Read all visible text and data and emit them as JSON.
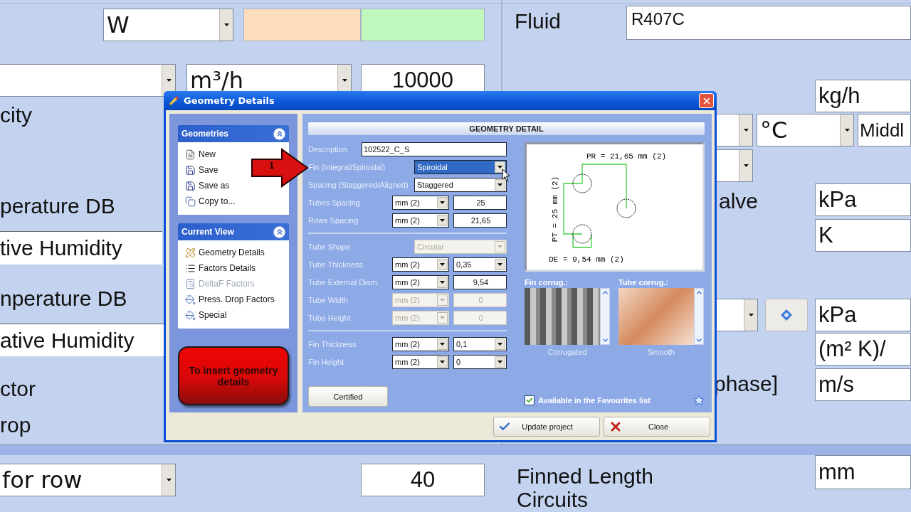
{
  "background": {
    "items": [
      {
        "kind": "combo",
        "text": "W"
      },
      {
        "kind": "swatch",
        "color": "#fddcbd"
      },
      {
        "kind": "swatch",
        "color": "#bff7bd"
      },
      {
        "kind": "combo"
      },
      {
        "kind": "combo",
        "text": "m³/h"
      },
      {
        "kind": "field",
        "text": "10000"
      },
      {
        "kind": "label",
        "text": "city"
      },
      {
        "kind": "label",
        "text": "perature DB"
      },
      {
        "kind": "strip",
        "text": "tive Humidity"
      },
      {
        "kind": "label",
        "text": "nperature DB"
      },
      {
        "kind": "strip",
        "text": "ative Humidity"
      },
      {
        "kind": "label",
        "text": "ctor"
      },
      {
        "kind": "label",
        "text": "rop"
      },
      {
        "kind": "combo",
        "text": "for row"
      },
      {
        "kind": "field",
        "text": "40"
      },
      {
        "kind": "label",
        "text": "Fluid"
      },
      {
        "kind": "field",
        "text": "R407C"
      },
      {
        "kind": "field",
        "text": "kg/h"
      },
      {
        "kind": "combo"
      },
      {
        "kind": "combo",
        "text": "°C"
      },
      {
        "kind": "field",
        "text": "Middl"
      },
      {
        "kind": "combo"
      },
      {
        "kind": "label",
        "text": "alve"
      },
      {
        "kind": "field",
        "text": "kPa"
      },
      {
        "kind": "field",
        "text": "K"
      },
      {
        "kind": "combo"
      },
      {
        "kind": "info"
      },
      {
        "kind": "field",
        "text": "kPa"
      },
      {
        "kind": "field",
        "text": "(m² K)/"
      },
      {
        "kind": "label",
        "text": "phase]"
      },
      {
        "kind": "field",
        "text": "m/s"
      },
      {
        "kind": "label",
        "text": "Finned Length"
      },
      {
        "kind": "field",
        "text": "mm"
      },
      {
        "kind": "label",
        "text": "Circuits"
      }
    ]
  },
  "dialog": {
    "title": "Geometry Details",
    "sidebar": {
      "groups": [
        {
          "title": "Geometries",
          "expanded": true,
          "items": [
            {
              "label": "New",
              "kind": "new",
              "disabled": false
            },
            {
              "label": "Save",
              "kind": "save",
              "disabled": false
            },
            {
              "label": "Save as",
              "kind": "save",
              "disabled": false
            },
            {
              "label": "Copy to...",
              "kind": "copy",
              "disabled": false
            }
          ]
        },
        {
          "title": "Current View",
          "expanded": true,
          "items": [
            {
              "label": "Geometry Details",
              "kind": "geometry",
              "disabled": false
            },
            {
              "label": "Factors Details",
              "kind": "factors",
              "disabled": false
            },
            {
              "label": "DeltaF Factors",
              "kind": "table",
              "disabled": true
            },
            {
              "label": "Press. Drop Factors",
              "kind": "bucket",
              "disabled": false
            },
            {
              "label": "Special",
              "kind": "bucket",
              "disabled": false
            }
          ]
        }
      ]
    },
    "callout": {
      "text": "To insert geometry details"
    },
    "arrow": {
      "label": "1"
    },
    "panel": {
      "header": "GEOMETRY DETAIL",
      "sections": [
        {
          "rows": [
            {
              "kind": "text",
              "label": "Description",
              "value": "102522_C_S",
              "disabled": false,
              "focused": false
            },
            {
              "kind": "select",
              "label": "Fin (Integral/Spiroidal)",
              "value": "Spiroidal",
              "disabled": false,
              "focused": true
            },
            {
              "kind": "select",
              "label": "Spacing (Staggered/Aligned)",
              "value": "Staggered",
              "disabled": false,
              "focused": false
            },
            {
              "kind": "unit_value",
              "label": "Tubes Spacing",
              "unit": "mm (2)",
              "value": "25",
              "disabled": false,
              "focused": false
            },
            {
              "kind": "unit_value",
              "label": "Rows Spacing",
              "unit": "mm (2)",
              "value": "21,65",
              "disabled": false,
              "focused": false
            }
          ]
        },
        {
          "rows": [
            {
              "kind": "select",
              "label": "Tube Shape",
              "value": "Circular",
              "disabled": true,
              "focused": false
            },
            {
              "kind": "unit_select",
              "label": "Tube Thickness",
              "unit": "mm (2)",
              "value": "0,35",
              "disabled": false,
              "focused": false
            },
            {
              "kind": "unit_value",
              "label": "Tube External Diam.",
              "unit": "mm (2)",
              "value": "9,54",
              "disabled": false,
              "focused": false
            },
            {
              "kind": "unit_value",
              "label": "Tube Width",
              "unit": "mm (2)",
              "value": "0",
              "disabled": true,
              "focused": false
            },
            {
              "kind": "unit_value",
              "label": "Tube Height",
              "unit": "mm (2)",
              "value": "0",
              "disabled": true,
              "focused": false
            }
          ]
        },
        {
          "rows": [
            {
              "kind": "unit_select",
              "label": "Fin Thickness",
              "unit": "mm (2)",
              "value": "0,1",
              "disabled": false,
              "focused": false
            },
            {
              "kind": "unit_select",
              "label": "Fin Height",
              "unit": "mm (2)",
              "value": "0",
              "disabled": false,
              "focused": false
            }
          ]
        }
      ],
      "certified": "Certified",
      "diagram": {
        "pr_label": "PR = 21,65 mm (2)",
        "pt_label": "PT = 25 mm (2)",
        "de_label": "DE = 9,54 mm (2)"
      },
      "corrugations": [
        {
          "kind": "fin",
          "title": "Fin corrug.:",
          "caption": "Corrugated"
        },
        {
          "kind": "tube",
          "title": "Tube corrug.:",
          "caption": "Smooth"
        }
      ],
      "favourites": {
        "label": "Available in the Favourites list",
        "checked": true
      }
    },
    "buttons": [
      {
        "kind": "update",
        "label": "Update project"
      },
      {
        "kind": "close",
        "label": "Close"
      }
    ]
  }
}
